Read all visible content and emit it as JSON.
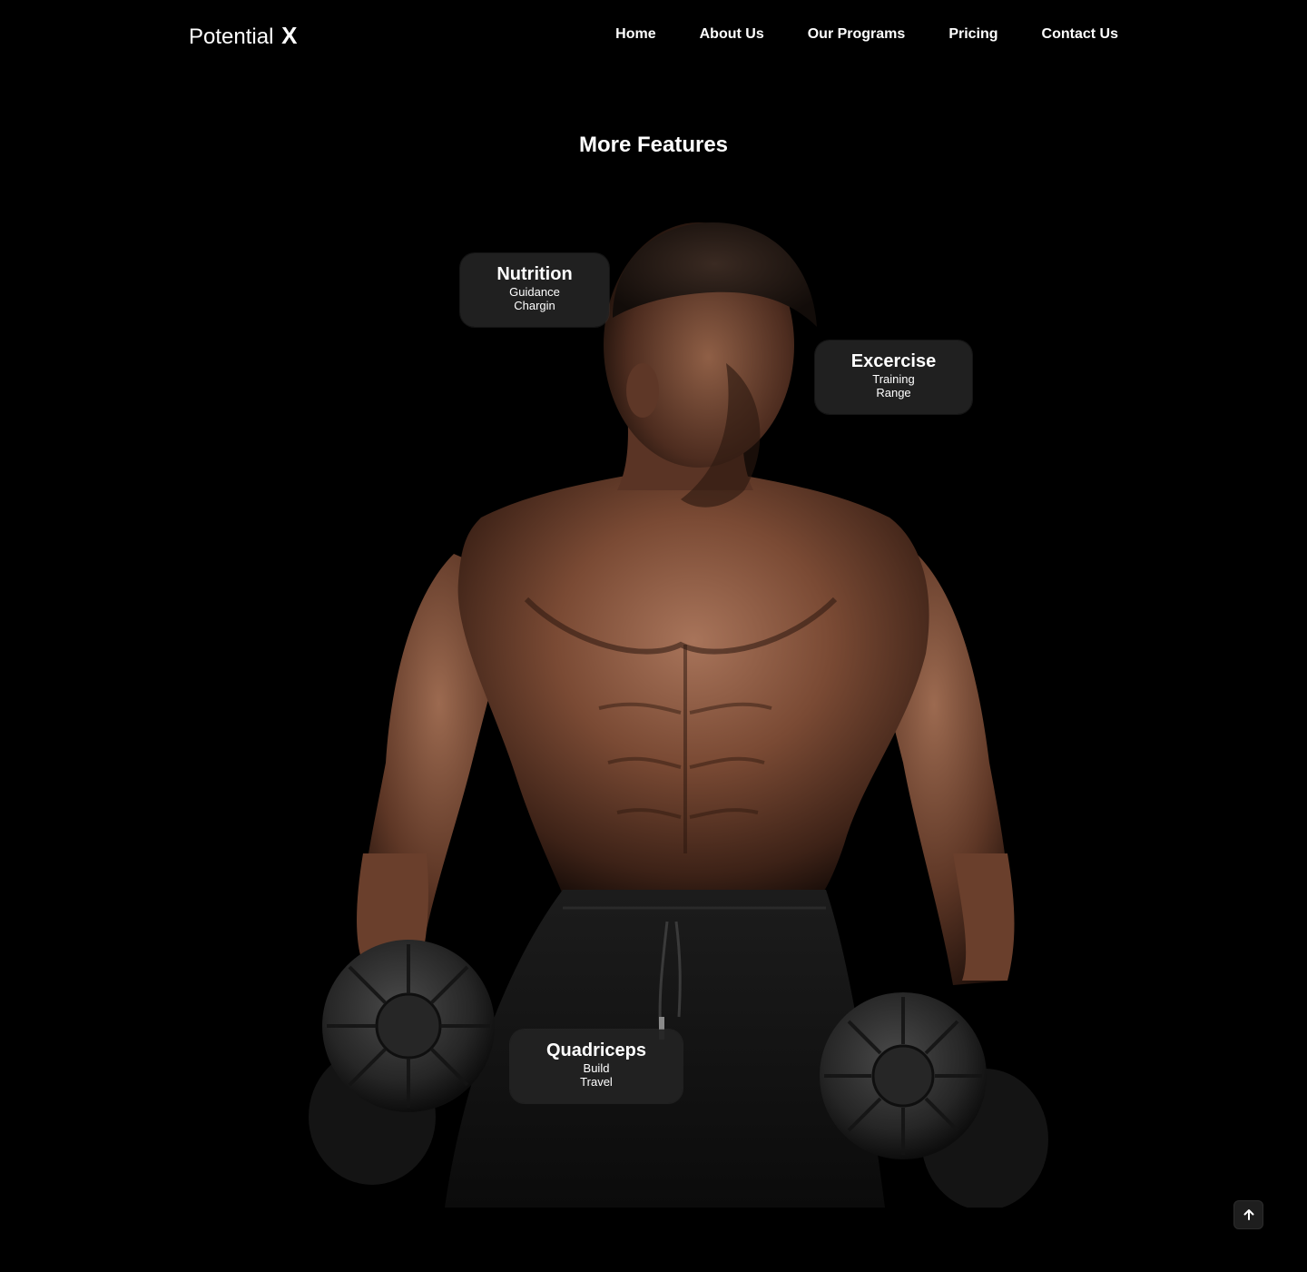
{
  "header": {
    "logo_text": "Potential",
    "logo_accent": "X",
    "nav": [
      {
        "label": "Home"
      },
      {
        "label": "About Us"
      },
      {
        "label": "Our Programs"
      },
      {
        "label": "Pricing"
      },
      {
        "label": "Contact Us"
      }
    ]
  },
  "features": {
    "title": "More Features",
    "cards": [
      {
        "title": "Nutrition",
        "line1": "Guidance",
        "line2": "Chargin"
      },
      {
        "title": "Excercise",
        "line1": "Training",
        "line2": "Range"
      },
      {
        "title": "Quadriceps",
        "line1": "Build",
        "line2": "Travel"
      }
    ]
  },
  "hero_image": {
    "subject": "athlete-with-dumbbells-icon"
  },
  "scroll_top": {
    "icon": "arrow-up-icon"
  },
  "colors": {
    "background": "#000000",
    "card_bg": "#222222",
    "text": "#ffffff"
  }
}
